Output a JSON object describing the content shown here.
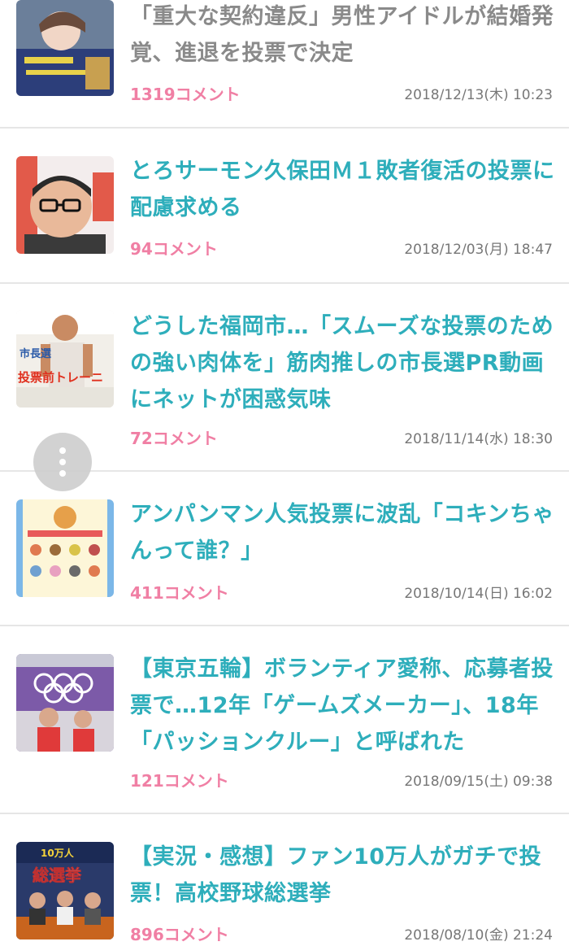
{
  "articles": [
    {
      "title": "「重大な契約違反」男性アイドルが結婚発覚、進退を投票で決定",
      "comments": "1319コメント",
      "date": "2018/12/13(木) 10:23",
      "thumb": "idol-portrait-icon"
    },
    {
      "title": "とろサーモン久保田Ｍ１敗者復活の投票に配慮求める",
      "comments": "94コメント",
      "date": "2018/12/03(月) 18:47",
      "thumb": "comedian-portrait-icon"
    },
    {
      "title": "どうした福岡市…「スムーズな投票のための強い肉体を」筋肉推しの市長選PR動画にネットが困惑気味",
      "comments": "72コメント",
      "date": "2018/11/14(水) 18:30",
      "thumb": "fukuoka-poster-icon",
      "thumb_text_1": "市長選",
      "thumb_text_2": "投票前トレーニ"
    },
    {
      "title": "アンパンマン人気投票に波乱「コキンちゃんって誰？」",
      "comments": "411コメント",
      "date": "2018/10/14(日) 16:02",
      "thumb": "anpanman-ranking-icon"
    },
    {
      "title": "【東京五輪】ボランティア愛称、応募者投票で…12年「ゲームズメーカー」、18年「パッションクルー」と呼ばれた",
      "comments": "121コメント",
      "date": "2018/09/15(土) 09:38",
      "thumb": "olympic-rings-icon"
    },
    {
      "title": "【実況・感想】ファン10万人がガチで投票！高校野球総選挙",
      "comments": "896コメント",
      "date": "2018/08/10(金) 21:24",
      "thumb": "baseball-show-icon",
      "thumb_text_1": "10万人",
      "thumb_text_2": "総選挙"
    }
  ],
  "menu_button": "more-vertical-icon"
}
